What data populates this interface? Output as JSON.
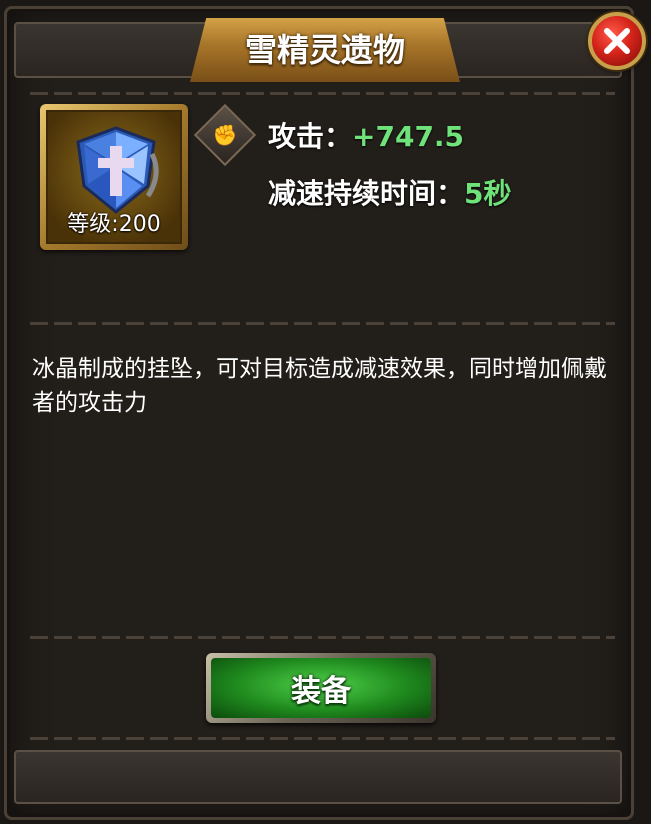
{
  "header": {
    "title": "雪精灵遗物",
    "close_icon": "close-x-icon"
  },
  "item": {
    "icon": "ice-crystal-pendant-icon",
    "level_text": "等级:200",
    "badge_icon": "fist-attack-icon"
  },
  "stats": [
    {
      "label": "攻击：",
      "value": "+747.5"
    },
    {
      "label": "减速持续时间：",
      "value": "5秒"
    }
  ],
  "description": "冰晶制成的挂坠，可对目标造成减速效果，同时增加佩戴者的攻击力",
  "actions": {
    "equip_label": "装备"
  },
  "colors": {
    "accent_green": "#6fe27a",
    "banner_gold": "#c9963a",
    "close_red": "#d4241a"
  }
}
